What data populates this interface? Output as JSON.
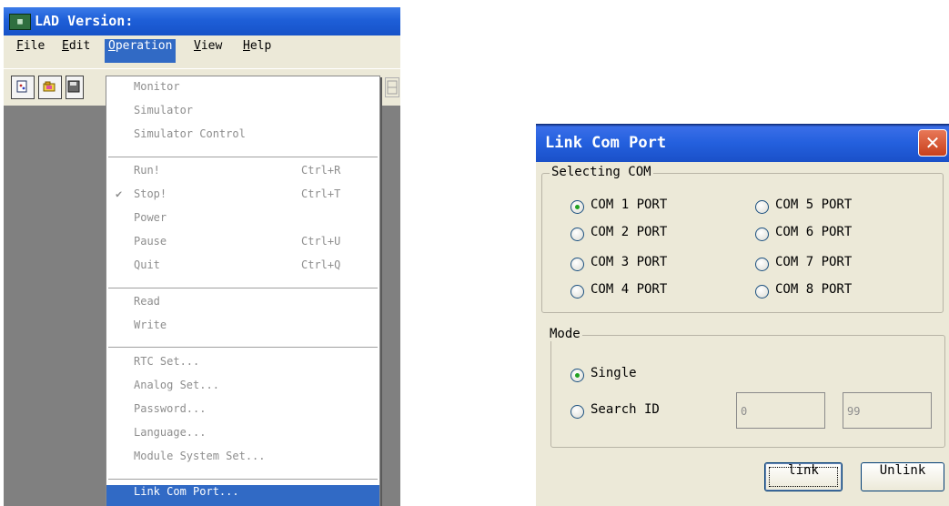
{
  "app": {
    "title": "LAD Version:",
    "menubar": {
      "file": {
        "first": "F",
        "rest": "ile"
      },
      "edit": {
        "first": "E",
        "rest": "dit"
      },
      "operation": {
        "first": "O",
        "rest": "peration"
      },
      "view": {
        "first": "V",
        "rest": "iew"
      },
      "help": {
        "first": "H",
        "rest": "elp"
      }
    },
    "toolbar_icons": [
      "new-file-icon",
      "open-folder-icon",
      "save-icon",
      "grid-icon"
    ]
  },
  "operation_menu": {
    "items": [
      {
        "label": "Monitor",
        "shortcut": ""
      },
      {
        "label": "Simulator",
        "shortcut": ""
      },
      {
        "label": "Simulator Control",
        "shortcut": ""
      },
      {
        "label": "Run!",
        "shortcut": "Ctrl+R"
      },
      {
        "label": "Stop!",
        "shortcut": "Ctrl+T",
        "checked": true,
        "check_mark": "✔"
      },
      {
        "label": "Power",
        "shortcut": ""
      },
      {
        "label": "Pause",
        "shortcut": "Ctrl+U"
      },
      {
        "label": "Quit",
        "shortcut": "Ctrl+Q"
      },
      {
        "label": "Read",
        "shortcut": ""
      },
      {
        "label": "Write",
        "shortcut": ""
      },
      {
        "label": "RTC Set...",
        "shortcut": ""
      },
      {
        "label": "Analog Set...",
        "shortcut": ""
      },
      {
        "label": "Password...",
        "shortcut": ""
      },
      {
        "label": "Language...",
        "shortcut": ""
      },
      {
        "label": "Module System Set...",
        "shortcut": ""
      },
      {
        "label": "Link Com Port...",
        "shortcut": "",
        "highlighted": true
      }
    ]
  },
  "dialog": {
    "title": "Link Com Port",
    "close_glyph": "✕",
    "selecting_com": {
      "legend": "Selecting COM",
      "ports": [
        {
          "label": "COM 1 PORT",
          "selected": true
        },
        {
          "label": "COM 2 PORT",
          "selected": false
        },
        {
          "label": "COM 3 PORT",
          "selected": false
        },
        {
          "label": "COM 4 PORT",
          "selected": false
        },
        {
          "label": "COM 5 PORT",
          "selected": false
        },
        {
          "label": "COM 6 PORT",
          "selected": false
        },
        {
          "label": "COM 7 PORT",
          "selected": false
        },
        {
          "label": "COM 8 PORT",
          "selected": false
        }
      ]
    },
    "mode": {
      "legend": "Mode",
      "single_label": "Single",
      "single_selected": true,
      "search_label": "Search ID",
      "search_selected": false,
      "id_from": "0",
      "id_to": "99"
    },
    "buttons": {
      "link": "link",
      "unlink": "Unlink"
    }
  },
  "colors": {
    "titlebar": "#1e5fd8",
    "menu_highlight": "#316ac5",
    "window_face": "#ece9d8",
    "workspace": "#808080",
    "disabled_text": "#8e8e8e",
    "radio_dot": "#21a121"
  }
}
